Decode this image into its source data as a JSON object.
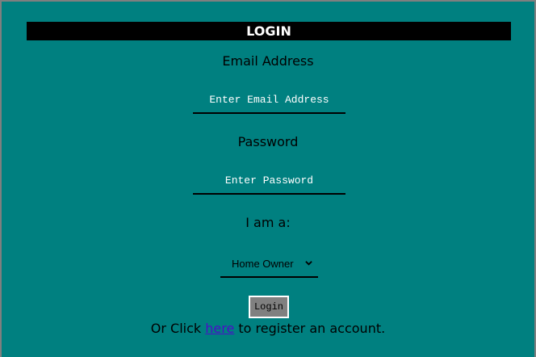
{
  "header": {
    "title": "LOGIN"
  },
  "form": {
    "email_label": "Email Address",
    "email_placeholder": "Enter Email Address",
    "password_label": "Password",
    "password_placeholder": "Enter Password",
    "role_label": "I am a:",
    "role_value": "Home Owner",
    "login_button": "Login"
  },
  "footer": {
    "prefix": "Or Click ",
    "link_text": "here",
    "suffix": " to register an account."
  },
  "colors": {
    "background": "#008080",
    "banner": "#000000",
    "button": "#808080",
    "link": "#4b0dc8"
  },
  "icons": {
    "select_chevron": "chevron-down-icon"
  }
}
